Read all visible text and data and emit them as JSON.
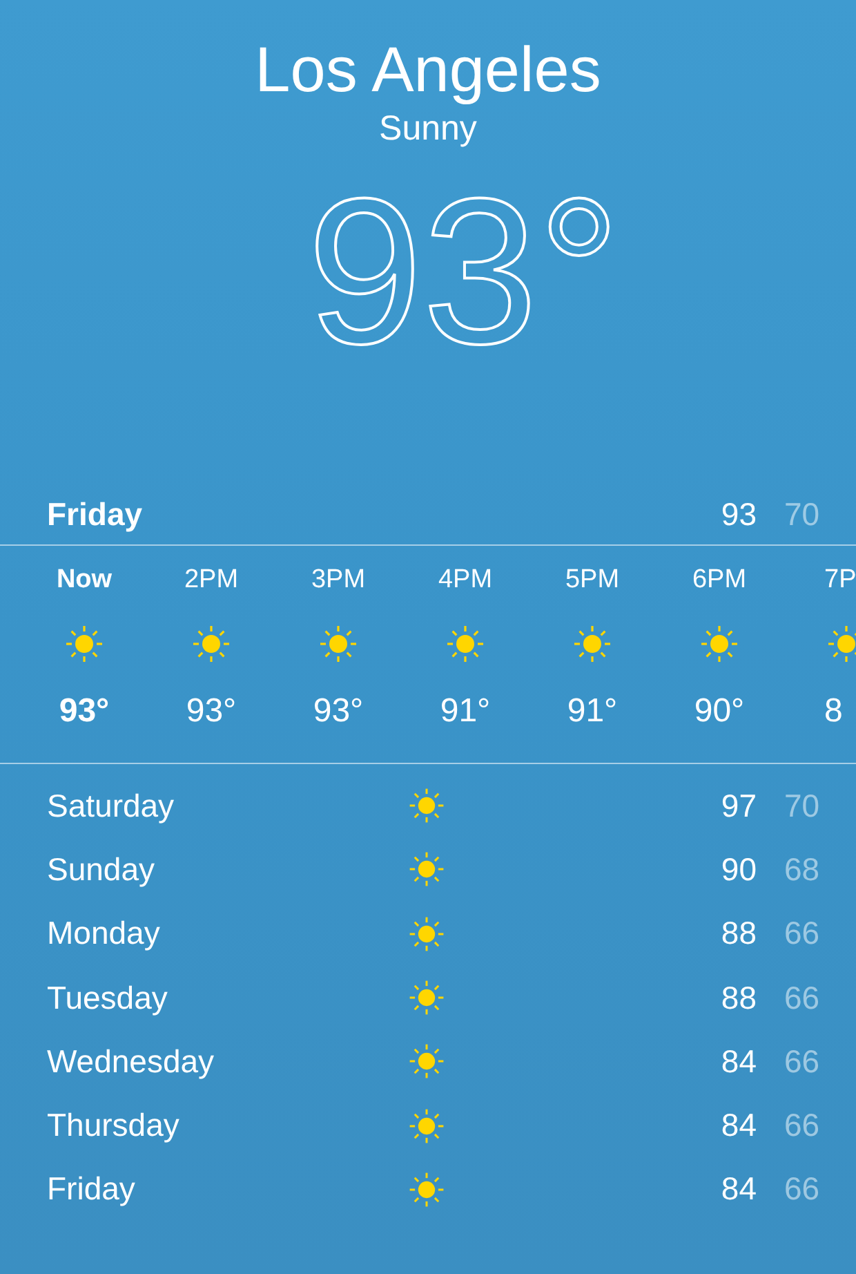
{
  "header": {
    "city": "Los Angeles",
    "condition": "Sunny",
    "temperature": "93°"
  },
  "today": {
    "day": "Friday",
    "high": "93",
    "low": "70"
  },
  "hourly": [
    {
      "time": "Now",
      "temp": "93°",
      "current": true
    },
    {
      "time": "2PM",
      "temp": "93°",
      "current": false
    },
    {
      "time": "3PM",
      "temp": "93°",
      "current": false
    },
    {
      "time": "4PM",
      "temp": "91°",
      "current": false
    },
    {
      "time": "5PM",
      "temp": "91°",
      "current": false
    },
    {
      "time": "6PM",
      "temp": "90°",
      "current": false
    },
    {
      "time": "7P",
      "temp": "8",
      "current": false
    }
  ],
  "daily": [
    {
      "day": "Saturday",
      "high": "97",
      "low": "70"
    },
    {
      "day": "Sunday",
      "high": "90",
      "low": "68"
    },
    {
      "day": "Monday",
      "high": "88",
      "low": "66"
    },
    {
      "day": "Tuesday",
      "high": "88",
      "low": "66"
    },
    {
      "day": "Wednesday",
      "high": "84",
      "low": "66"
    },
    {
      "day": "Thursday",
      "high": "84",
      "low": "66"
    },
    {
      "day": "Friday",
      "high": "84",
      "low": "66"
    }
  ]
}
